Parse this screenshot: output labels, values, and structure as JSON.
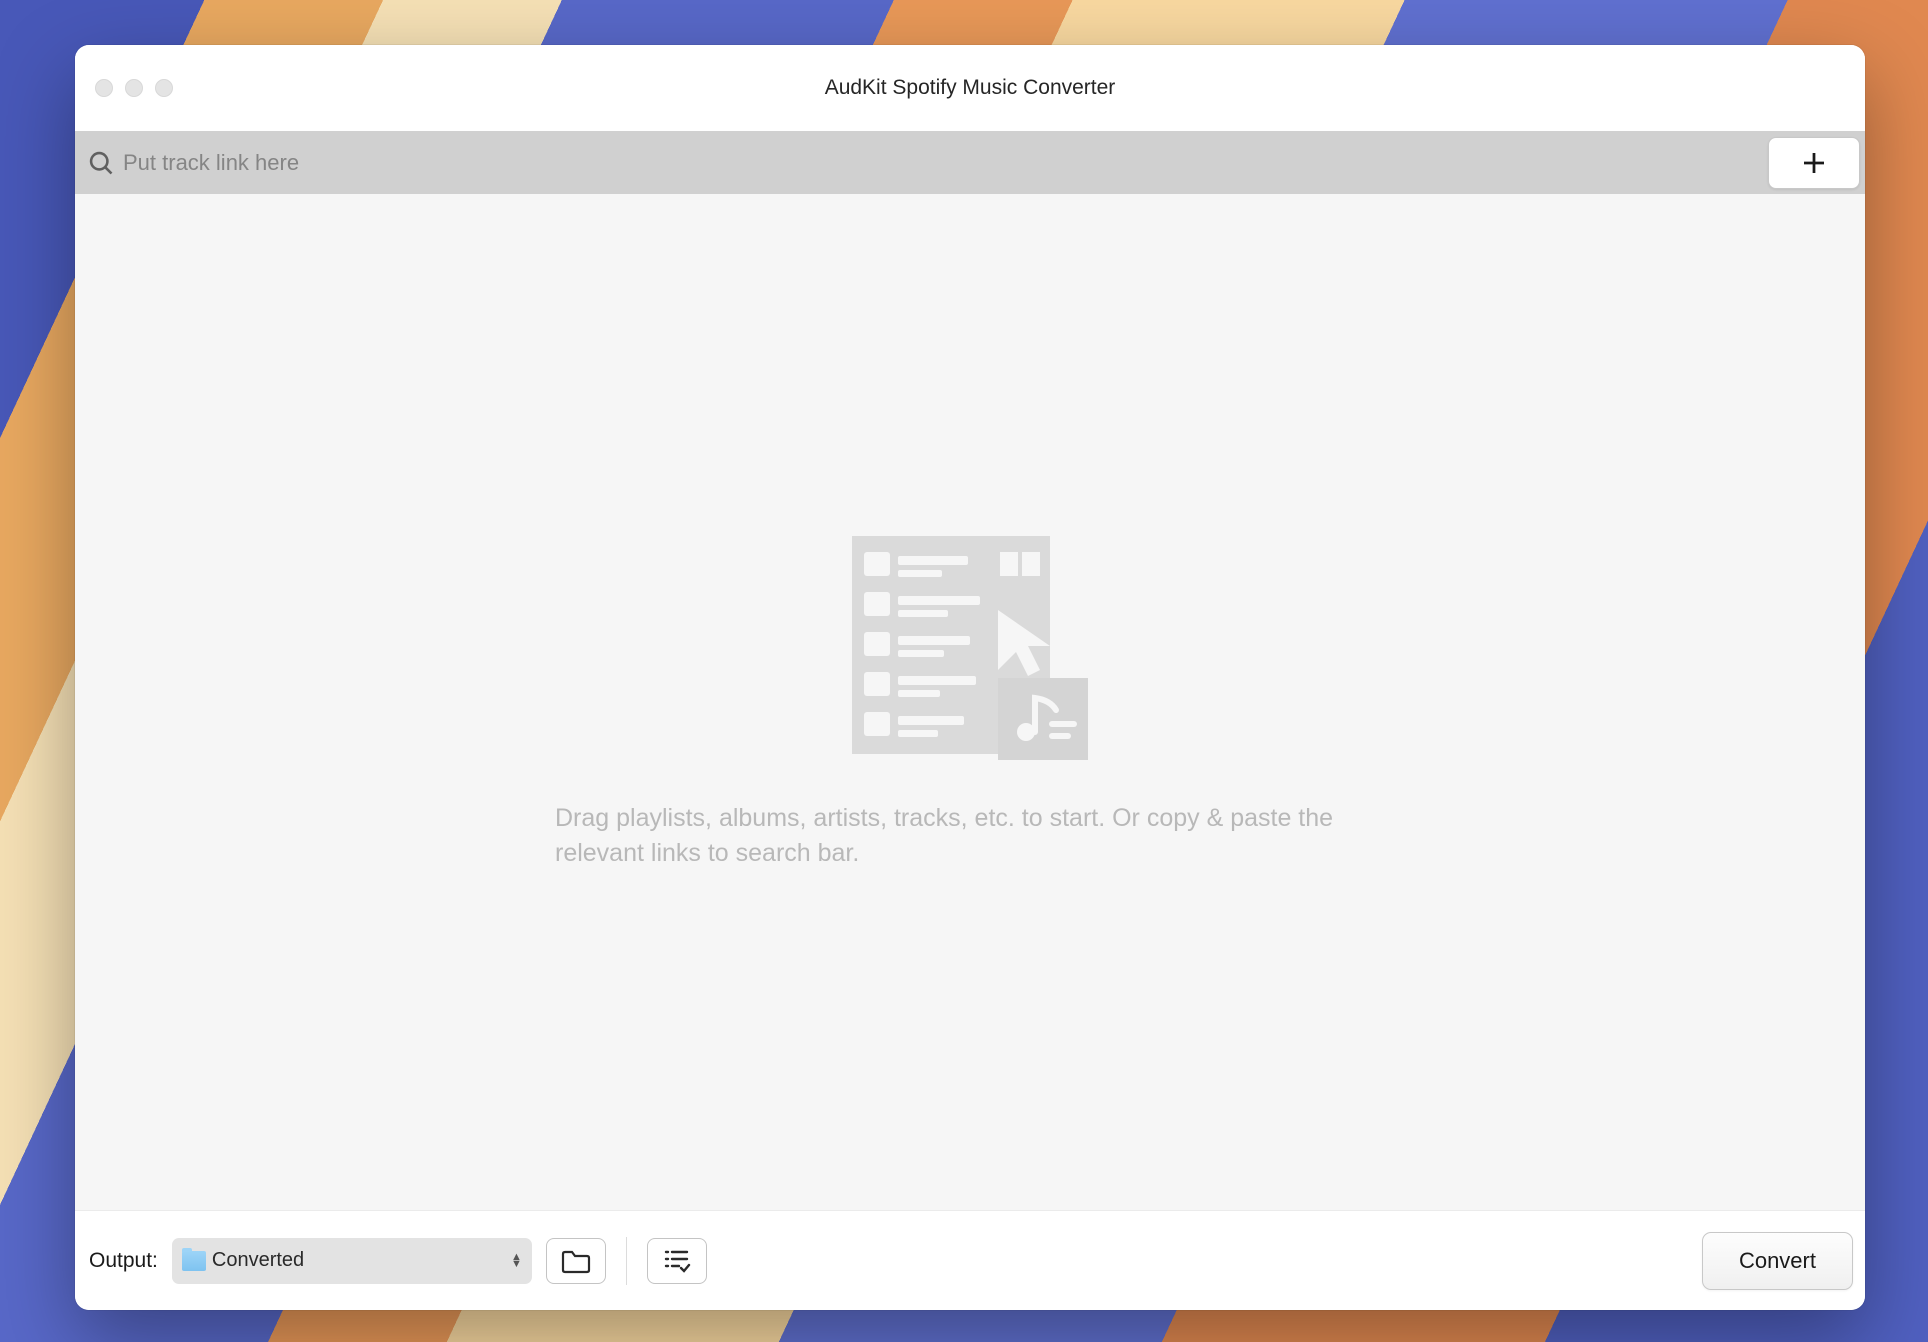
{
  "window": {
    "title": "AudKit Spotify Music Converter"
  },
  "search": {
    "placeholder": "Put track link here",
    "value": ""
  },
  "empty_state": {
    "message": "Drag playlists, albums, artists, tracks, etc. to start. Or copy & paste the relevant links to search bar."
  },
  "footer": {
    "output_label": "Output:",
    "output_folder": "Converted",
    "convert_label": "Convert"
  }
}
